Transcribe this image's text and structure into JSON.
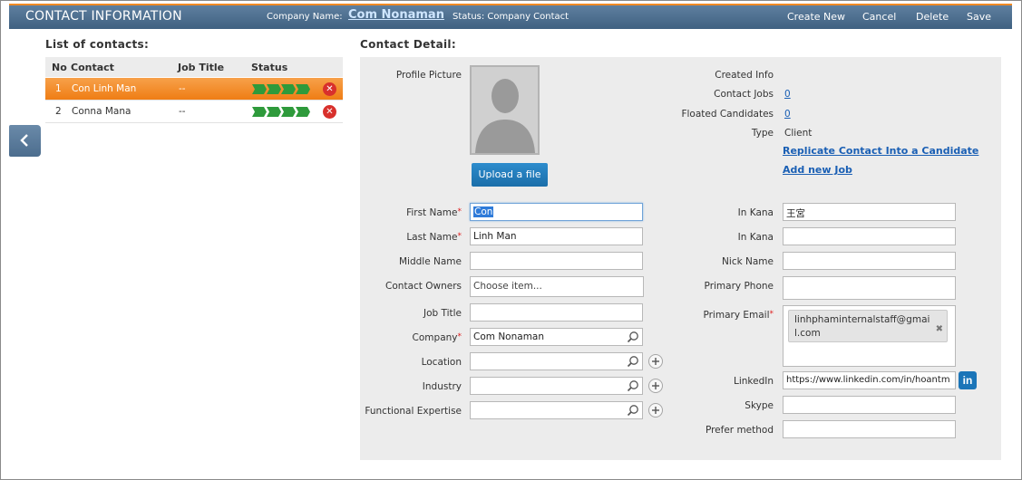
{
  "header": {
    "title": "CONTACT INFORMATION",
    "company_label": "Company Name:",
    "company_name": "Com Nonaman",
    "status_text": "Status: Company Contact",
    "actions": {
      "create_new": "Create New",
      "cancel": "Cancel",
      "delete": "Delete",
      "save": "Save"
    }
  },
  "contacts_list": {
    "title": "List of contacts:",
    "columns": {
      "no": "No",
      "contact": "Contact",
      "job_title": "Job Title",
      "status": "Status"
    },
    "rows": [
      {
        "no": "1",
        "contact": "Con Linh Man",
        "job_title": "--",
        "status_steps": 4,
        "selected": true
      },
      {
        "no": "2",
        "contact": "Conna Mana",
        "job_title": "--",
        "status_steps": 4,
        "selected": false
      }
    ]
  },
  "detail": {
    "title": "Contact Detail:",
    "profile_picture_label": "Profile Picture",
    "upload_button": "Upload a file",
    "info": {
      "created_info_label": "Created Info",
      "contact_jobs_label": "Contact Jobs",
      "contact_jobs_value": "0",
      "floated_candidates_label": "Floated Candidates",
      "floated_candidates_value": "0",
      "type_label": "Type",
      "type_value": "Client",
      "replicate_link": "Replicate Contact Into a Candidate",
      "add_job_link": "Add new Job"
    },
    "left_fields": {
      "first_name": {
        "label": "First Name",
        "value": "Con"
      },
      "last_name": {
        "label": "Last Name",
        "value": "Linh Man"
      },
      "middle_name": {
        "label": "Middle Name",
        "value": ""
      },
      "contact_owners": {
        "label": "Contact Owners",
        "placeholder": "Choose item..."
      },
      "job_title": {
        "label": "Job Title",
        "value": ""
      },
      "company": {
        "label": "Company",
        "value": "Com Nonaman"
      },
      "location": {
        "label": "Location",
        "value": ""
      },
      "industry": {
        "label": "Industry",
        "value": ""
      },
      "functional_expertise": {
        "label": "Functional Expertise",
        "value": ""
      }
    },
    "right_fields": {
      "in_kana_1": {
        "label": "In Kana",
        "value": "王宮"
      },
      "in_kana_2": {
        "label": "In Kana",
        "value": ""
      },
      "nick_name": {
        "label": "Nick Name",
        "value": ""
      },
      "primary_phone": {
        "label": "Primary Phone",
        "value": ""
      },
      "primary_email": {
        "label": "Primary Email",
        "tag": "linhphaminternalstaff@gmail.com"
      },
      "linkedin": {
        "label": "LinkedIn",
        "value": "https://www.linkedin.com/in/hoantm"
      },
      "skype": {
        "label": "Skype",
        "value": ""
      },
      "prefer_method": {
        "label": "Prefer method",
        "value": ""
      }
    }
  },
  "colors": {
    "header_bg": "#4f7191",
    "accent_orange": "#f08a24",
    "link_blue": "#1a5fb4",
    "status_green": "#2e9a3b",
    "delete_red": "#d8302c"
  }
}
